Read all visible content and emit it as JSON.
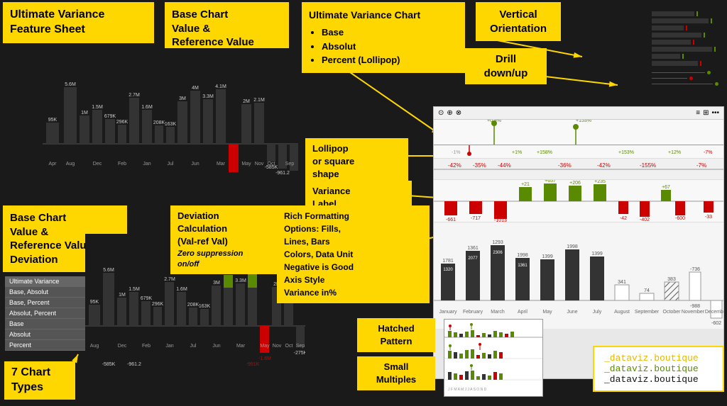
{
  "title": "Ultimate Variance Feature Sheet",
  "callouts": {
    "title": "Ultimate Variance Feature Sheet",
    "base_ref": "Base Chart\nValue &\nReference Value",
    "chart_types_title": "Ultimate Variance Chart",
    "chart_types_list": [
      "Base",
      "Absolut",
      "Percent (Lollipop)"
    ],
    "vertical": "Vertical\nOrientation",
    "drill": "Drill\ndown/up",
    "lollipop": "Lollipop\nor square\nshape",
    "variance_label": "Variance\nLabel\nColor",
    "base_ref_deviation": "Base Chart\nValue &\nReference Value\nDeviation",
    "deviation_calc": "Deviation\nCalculation\n(Val-ref Val)\nZero suppression\non/off",
    "rich_formatting": "Rich Formatting\nOptions: Fills,\nLines, Bars\nColors, Data Unit\nNegative is Good\nAxis Style\nVariance in%",
    "hatched": "Hatched\nPattern",
    "small_multiples": "Small\nMultiples",
    "seven_chart_types": "7 Chart\nTypes"
  },
  "chart_legend": {
    "items": [
      "Ultimate Variance",
      "Base, Absolut",
      "Base, Percent",
      "Absolut, Percent",
      "Base",
      "Absolut",
      "Percent"
    ]
  },
  "bar_values_top": [
    "95K",
    "5.6M",
    "1M",
    "1.5M",
    "679K",
    "296K",
    "2.7M",
    "1.6M",
    "208K",
    "163K",
    "3M",
    "3.3M",
    "4M",
    "4.1M",
    "2M",
    "2.1M",
    "-585K",
    "-961.2",
    "-1.6M",
    "-991K",
    "-275K"
  ],
  "bar_months_top": [
    "Apr",
    "Aug",
    "Dec",
    "Feb",
    "Jan",
    "Jul",
    "Jun",
    "Mar",
    "May",
    "Nov",
    "Oct",
    "Sep"
  ],
  "branding": {
    "line1": "_dataviz.boutique",
    "line2": "_dataviz.boutique",
    "line3": "_dataviz.boutique"
  },
  "main_chart_months": [
    "January",
    "February",
    "March",
    "April",
    "May",
    "June",
    "July",
    "August",
    "September",
    "October",
    "November",
    "December"
  ],
  "main_chart_values": [
    1320,
    2077,
    2306,
    1361,
    1293,
    1998,
    1399,
    341,
    74,
    383,
    736,
    602
  ],
  "accent_color": "#FFD700",
  "pos_color": "#5a8a00",
  "neg_color": "#cc0000"
}
